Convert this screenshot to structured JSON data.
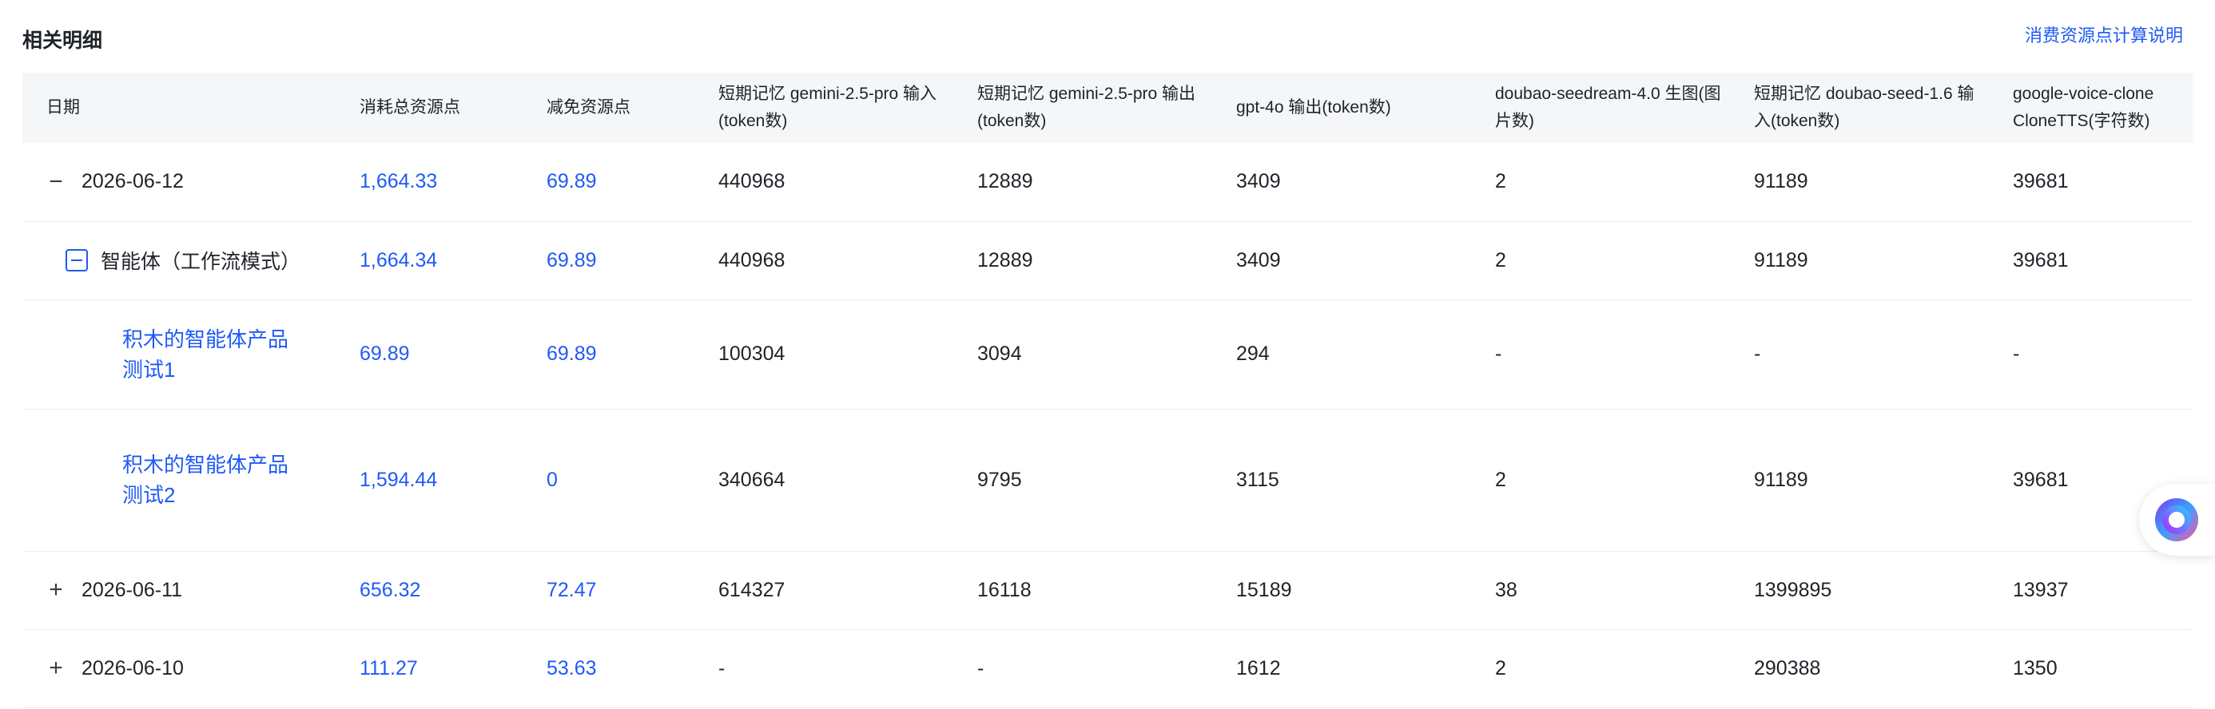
{
  "section": {
    "title": "相关明细",
    "explain_link": "消费资源点计算说明"
  },
  "table": {
    "headers": {
      "date": "日期",
      "total": "消耗总资源点",
      "discount": "减免资源点",
      "col1": "短期记忆 gemini-2.5-pro 输入(token数)",
      "col2": "短期记忆 gemini-2.5-pro 输出(token数)",
      "col3": "gpt-4o 输出(token数)",
      "col4": "doubao-seedream-4.0 生图(图片数)",
      "col5": "短期记忆 doubao-seed-1.6 输入(token数)",
      "col6": "google-voice-clone CloneTTS(字符数)"
    },
    "rows": [
      {
        "label": "2026-06-12",
        "total": "1,664.33",
        "discount": "69.89",
        "c1": "440968",
        "c2": "12889",
        "c3": "3409",
        "c4": "2",
        "c5": "91189",
        "c6": "39681"
      },
      {
        "label": "智能体（工作流模式）",
        "total": "1,664.34",
        "discount": "69.89",
        "c1": "440968",
        "c2": "12889",
        "c3": "3409",
        "c4": "2",
        "c5": "91189",
        "c6": "39681"
      },
      {
        "label": "积木的智能体产品测试1",
        "total": "69.89",
        "discount": "69.89",
        "c1": "100304",
        "c2": "3094",
        "c3": "294",
        "c4": "-",
        "c5": "-",
        "c6": "-"
      },
      {
        "label": "积木的智能体产品测试2",
        "total": "1,594.44",
        "discount": "0",
        "c1": "340664",
        "c2": "9795",
        "c3": "3115",
        "c4": "2",
        "c5": "91189",
        "c6": "39681"
      },
      {
        "label": "2026-06-11",
        "total": "656.32",
        "discount": "72.47",
        "c1": "614327",
        "c2": "16118",
        "c3": "15189",
        "c4": "38",
        "c5": "1399895",
        "c6": "13937"
      },
      {
        "label": "2026-06-10",
        "total": "111.27",
        "discount": "53.63",
        "c1": "-",
        "c2": "-",
        "c3": "1612",
        "c4": "2",
        "c5": "290388",
        "c6": "1350"
      }
    ]
  },
  "icons": {
    "collapse": "minus-icon",
    "expand": "plus-icon",
    "collapse_box": "minus-square-icon",
    "assistant": "assistant-orb-icon"
  },
  "colors": {
    "link": "#1f5af5",
    "header_bg": "#f5f6f8",
    "divider": "#eceef1",
    "text": "#1f2329"
  }
}
